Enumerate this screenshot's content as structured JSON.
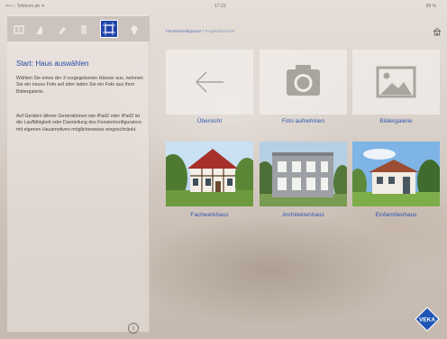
{
  "status_bar": {
    "carrier": "•••○○ Telekom.de ✦",
    "time": "17:23",
    "battery": "89 %"
  },
  "sidebar": {
    "tools": [
      {
        "icon": "floorplan-icon"
      },
      {
        "icon": "roof-icon"
      },
      {
        "icon": "paintbrush-icon"
      },
      {
        "icon": "window-icon"
      },
      {
        "icon": "frame-icon",
        "active": true
      },
      {
        "icon": "lightbulb-icon"
      }
    ],
    "title": "Start: Haus auswählen",
    "paragraph1": "Wählen Sie eines der 3 vorgegebenen Häuser aus, nehmen Sie ein neues Foto auf oder laden Sie ein Foto aus Ihrer Bildergalerie.",
    "paragraph2": "Auf Geräten älterer Generationen wie iPad2 oder iPad3 ist die Lauffähigkeit oder Darstellung des Fensterkonfigurators mit eigenen Hausmotiven möglicherweise eingeschränkt.",
    "info_label": "i"
  },
  "header": {
    "breadcrumb_root": "Fensterkonfigurator",
    "breadcrumb_sep": " / ",
    "breadcrumb_current": "Projektübersicht"
  },
  "tiles": [
    {
      "label": "Übersicht",
      "icon": "back-arrow-icon"
    },
    {
      "label": "Foto aufnehmen",
      "icon": "camera-icon"
    },
    {
      "label": "Bildergalerie",
      "icon": "image-gallery-icon"
    }
  ],
  "houses": [
    {
      "label": "Fachwerkhaus"
    },
    {
      "label": "Architektenhaus"
    },
    {
      "label": "Einfamilienhaus"
    }
  ],
  "brand": {
    "logo_text": "VEKA",
    "accent": "#2548a8",
    "link": "#2e57b4"
  }
}
